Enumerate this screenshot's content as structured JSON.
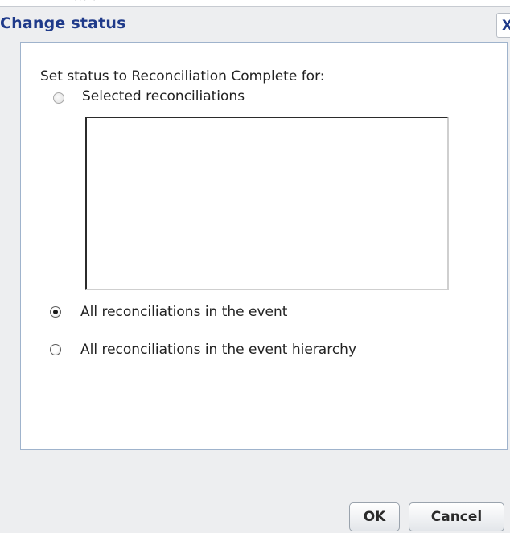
{
  "dialog": {
    "title": "Change status",
    "close_label": "X"
  },
  "content": {
    "prompt": "Set status to Reconciliation Complete for:",
    "options": [
      {
        "label": "Selected reconciliations",
        "checked": false,
        "enabled": false
      },
      {
        "label": "All reconciliations in the event",
        "checked": true,
        "enabled": true
      },
      {
        "label": "All reconciliations in the event hierarchy",
        "checked": false,
        "enabled": true
      }
    ],
    "reconciliation_list": []
  },
  "buttons": {
    "ok_label": "OK",
    "cancel_label": "Cancel"
  }
}
